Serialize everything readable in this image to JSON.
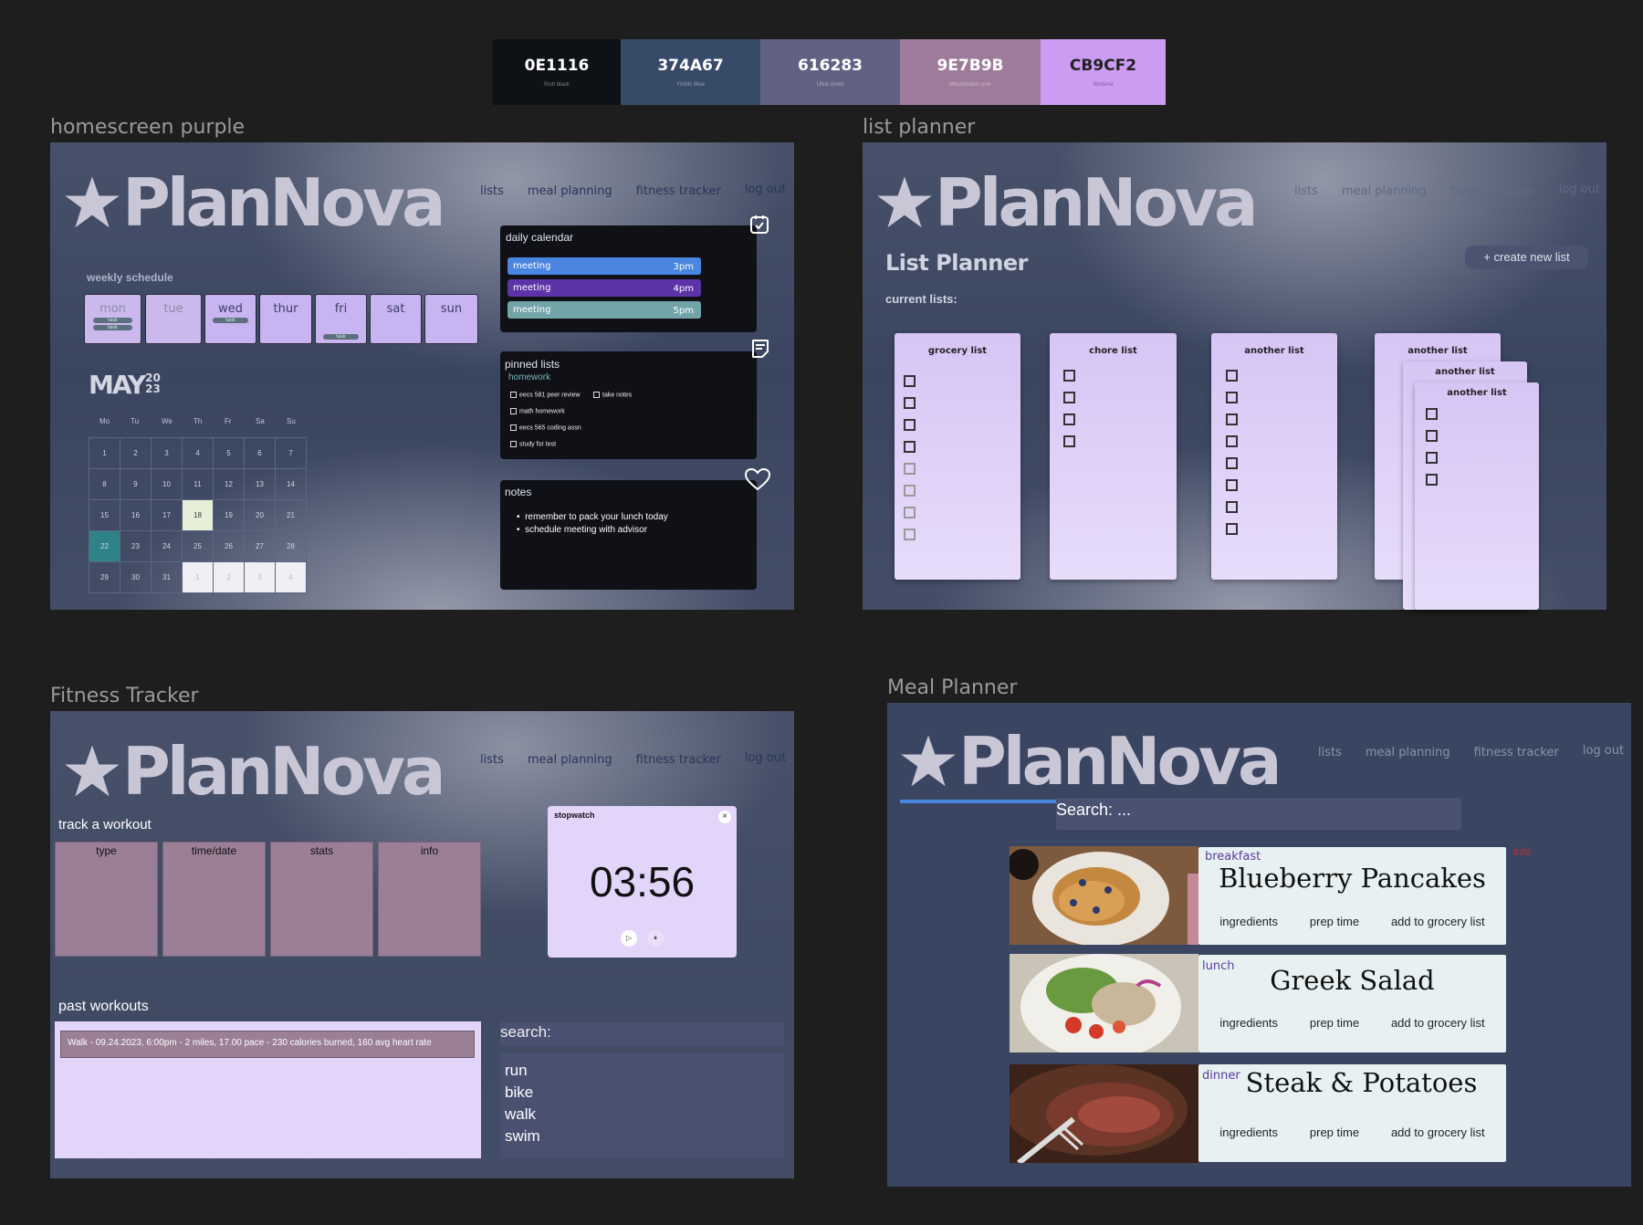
{
  "palette": [
    {
      "hex": "0E1116",
      "name": "Rich black",
      "color": "#0E1116"
    },
    {
      "hex": "374A67",
      "name": "YInMn Blue",
      "color": "#374A67"
    },
    {
      "hex": "616283",
      "name": "Ultra Violet",
      "color": "#616283"
    },
    {
      "hex": "9E7B9B",
      "name": "Mountbatten pink",
      "color": "#9E7B9B"
    },
    {
      "hex": "CB9CF2",
      "name": "Wisteria",
      "color": "#CB9CF2"
    }
  ],
  "brand": {
    "name": "PlanNova"
  },
  "nav": {
    "lists": "lists",
    "meal": "meal planning",
    "fitness": "fitness tracker",
    "logout": "log out"
  },
  "home": {
    "frame_label": "homescreen purple",
    "weekly_title": "weekly schedule",
    "days": [
      "mon",
      "tue",
      "wed",
      "thur",
      "fri",
      "sat",
      "sun"
    ],
    "task_label": "task",
    "month": "MAY",
    "year_top": "20",
    "year_bottom": "23",
    "dow": [
      "Mo",
      "Tu",
      "We",
      "Th",
      "Fr",
      "Sa",
      "Su"
    ],
    "calendar_rows": [
      [
        "1",
        "2",
        "3",
        "4",
        "5",
        "6",
        "7"
      ],
      [
        "8",
        "9",
        "10",
        "11",
        "12",
        "13",
        "14"
      ],
      [
        "15",
        "16",
        "17",
        "18",
        "19",
        "20",
        "21"
      ],
      [
        "22",
        "23",
        "24",
        "25",
        "26",
        "27",
        "28"
      ],
      [
        "29",
        "30",
        "31",
        "1",
        "2",
        "3",
        "4"
      ]
    ],
    "daily_calendar": {
      "title": "daily calendar",
      "events": [
        {
          "label": "meeting",
          "time": "3pm",
          "color": "#4a86e0"
        },
        {
          "label": "meeting",
          "time": "4pm",
          "color": "#5d34a8"
        },
        {
          "label": "meeting",
          "time": "5pm",
          "color": "#72a5a8"
        }
      ]
    },
    "pinned": {
      "title": "pinned lists",
      "subtitle": "homework",
      "items": [
        "eecs 581 peer review",
        "take notes",
        "math homework",
        "eecs 565 coding assn",
        "study for test"
      ]
    },
    "notes": {
      "title": "notes",
      "items": [
        "remember to pack your lunch today",
        "schedule meeting with advisor"
      ]
    }
  },
  "lists": {
    "frame_label": "list planner",
    "heading": "List Planner",
    "current": "current lists:",
    "create": "+ create new list",
    "cards": [
      "grocery list",
      "chore list",
      "another list",
      "another list",
      "another list",
      "another list"
    ]
  },
  "fitness": {
    "frame_label": "Fitness Tracker",
    "track_title": "track a workout",
    "columns": [
      "type",
      "time/date",
      "stats",
      "info"
    ],
    "stopwatch_title": "stopwatch",
    "stopwatch_time": "03:56",
    "past_title": "past workouts",
    "past_entry": "Walk - 09.24.2023,  6:00pm -  2 miles, 17.00 pace - 230 calories burned, 160 avg heart rate",
    "search_label": "search:",
    "options": [
      "run",
      "bike",
      "walk",
      "swim"
    ]
  },
  "meal": {
    "frame_label": "Meal Planner",
    "search_placeholder": "Search: ...",
    "info": "info",
    "meals": [
      {
        "category": "breakfast",
        "title": "Blueberry Pancakes"
      },
      {
        "category": "lunch",
        "title": "Greek Salad"
      },
      {
        "category": "dinner",
        "title": "Steak & Potatoes"
      }
    ],
    "actions": [
      "ingredients",
      "prep time",
      "add to grocery list"
    ]
  }
}
